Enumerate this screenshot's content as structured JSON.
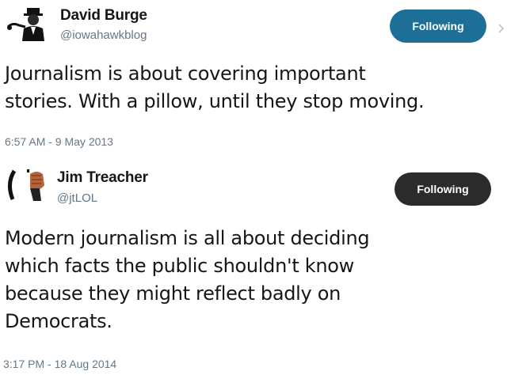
{
  "tweets": [
    {
      "display_name": "David Burge",
      "handle": "@iowahawkblog",
      "follow_label": "Following",
      "follow_color": "#1d6f97",
      "text_lines": [
        "Journalism is about covering important",
        "stories. With a pillow, until they stop moving."
      ],
      "timestamp": "6:57 AM - 9 May 2013",
      "avatar_icon": "person-silhouette-avatar"
    },
    {
      "display_name": "Jim Treacher",
      "handle": "@jtLOL",
      "follow_label": "Following",
      "follow_color": "#2b2b2b",
      "text_lines": [
        "Modern journalism is all about deciding",
        "which facts the public shouldn't know",
        "because they might reflect badly on",
        "Democrats."
      ],
      "timestamp": "3:17 PM - 18 Aug 2014",
      "avatar_icon": "raised-fist-avatar"
    }
  ],
  "colors": {
    "text": "#14171a",
    "secondary_text": "#657786",
    "background": "#ffffff"
  },
  "icons": {
    "partial_icon": "chevron-down-icon"
  }
}
